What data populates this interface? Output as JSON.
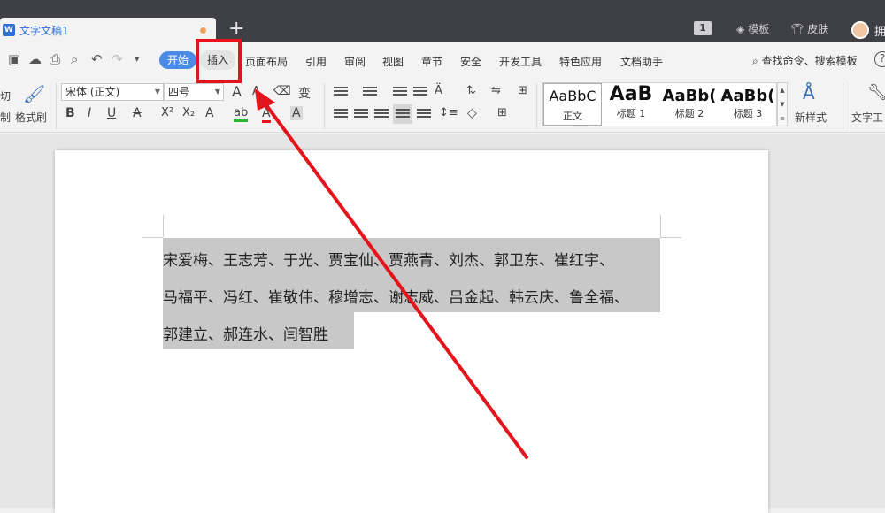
{
  "titlebar": {
    "doc_icon": "W",
    "tab_title": "文字文稿1",
    "add_tab": "+",
    "window_badge": "1",
    "template_label": "模板",
    "skin_label": "皮肤",
    "user_name_partial": "拥"
  },
  "menubar": {
    "items": [
      "开始",
      "插入",
      "页面布局",
      "引用",
      "审阅",
      "视图",
      "章节",
      "安全",
      "开发工具",
      "特色应用",
      "文档助手"
    ],
    "search_label": "查找命令、搜索模板",
    "help": "?"
  },
  "ribbon": {
    "cut_partial": "切",
    "copy_partial": "制",
    "format_painter": "格式刷",
    "font_name": "宋体 (正文)",
    "font_size": "四号",
    "bold": "B",
    "italic": "I",
    "underline": "U",
    "strike_a": "A",
    "superscript": "X²",
    "subscript": "X₂",
    "char_a": "A",
    "highlight": "ab",
    "font_color_a": "A",
    "shade_a": "A",
    "grow_a": "A",
    "shrink_a": "A",
    "phonetic": "变",
    "styles": [
      {
        "sample": "AaBbC",
        "name": "正文"
      },
      {
        "sample": "AaB",
        "name": "标题 1"
      },
      {
        "sample": "AaBb(",
        "name": "标题 2"
      },
      {
        "sample": "AaBb(",
        "name": "标题 3"
      }
    ],
    "new_style": "新样式",
    "text_tools": "文字工"
  },
  "document": {
    "lines": [
      "宋爱梅、王志芳、于光、贾宝仙、贾燕青、刘杰、郭卫东、崔红宇、",
      "马福平、冯红、崔敬伟、穆增志、谢志威、吕金起、韩云庆、鲁全福、",
      "郭建立、郝连水、闫智胜"
    ]
  },
  "colors": {
    "titlebar_bg": "#3f3f46",
    "accent_blue": "#4a8be8",
    "annotation_red": "#e5131b",
    "selection_gray": "#c8c8c8"
  }
}
